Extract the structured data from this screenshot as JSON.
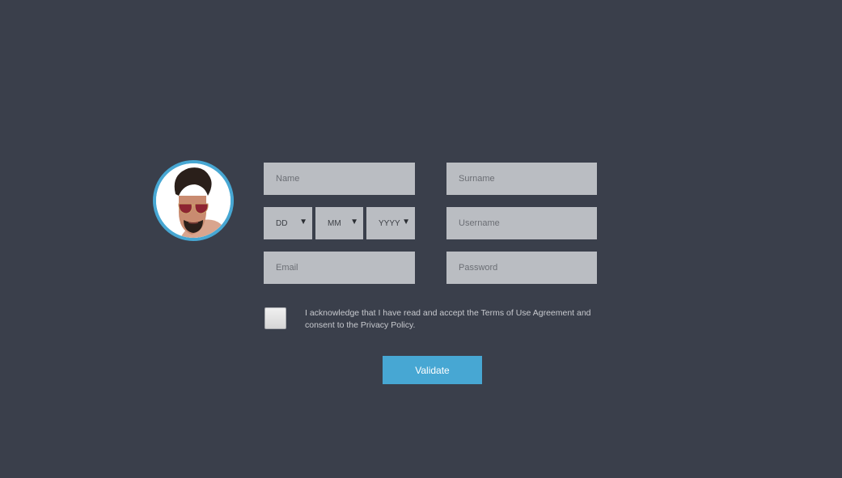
{
  "profile": {
    "avatar_alt": "profile photo"
  },
  "form": {
    "name_placeholder": "Name",
    "surname_placeholder": "Surname",
    "day_label": "DD",
    "month_label": "MM",
    "year_label": "YYYY",
    "username_placeholder": "Username",
    "email_placeholder": "Email",
    "password_placeholder": "Password",
    "terms_text": "I acknowledge that I have read and accept the Terms of Use Agreement and consent to the Privacy Policy.",
    "terms_checked": false,
    "submit_label": "Validate"
  },
  "icons": {
    "select_arrow": "dropdown-arrow-icon"
  },
  "colors": {
    "background": "#3a3f4b",
    "field": "#babdc2",
    "accent": "#47a7d3",
    "text_muted": "#c7c9ce"
  }
}
